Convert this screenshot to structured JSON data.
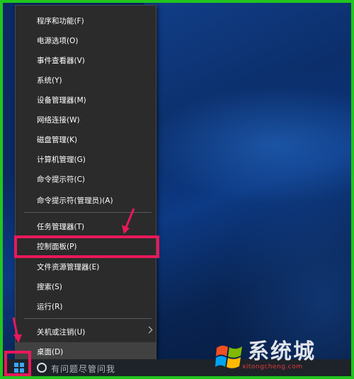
{
  "menu": {
    "items": [
      {
        "label": "程序和功能(F)"
      },
      {
        "label": "电源选项(O)"
      },
      {
        "label": "事件查看器(V)"
      },
      {
        "label": "系统(Y)"
      },
      {
        "label": "设备管理器(M)"
      },
      {
        "label": "网络连接(W)"
      },
      {
        "label": "磁盘管理(K)"
      },
      {
        "label": "计算机管理(G)"
      },
      {
        "label": "命令提示符(C)"
      },
      {
        "label": "命令提示符(管理员)(A)"
      },
      {
        "label": "任务管理器(T)"
      },
      {
        "label": "控制面板(P)"
      },
      {
        "label": "文件资源管理器(E)"
      },
      {
        "label": "搜索(S)"
      },
      {
        "label": "运行(R)"
      },
      {
        "label": "关机或注销(U)"
      },
      {
        "label": "桌面(D)"
      }
    ],
    "highlighted_item": "控制面板(P)",
    "hovered_item": "桌面(D)"
  },
  "taskbar": {
    "search_placeholder": "有问题尽管问我",
    "start_icon": "windows-logo-icon",
    "cortana_icon": "cortana-circle-icon"
  },
  "annotations": {
    "color": "#e8195a",
    "frame_color": "#22c51e"
  },
  "watermark": {
    "text": "系统城",
    "url": "xitongcheng.com"
  }
}
